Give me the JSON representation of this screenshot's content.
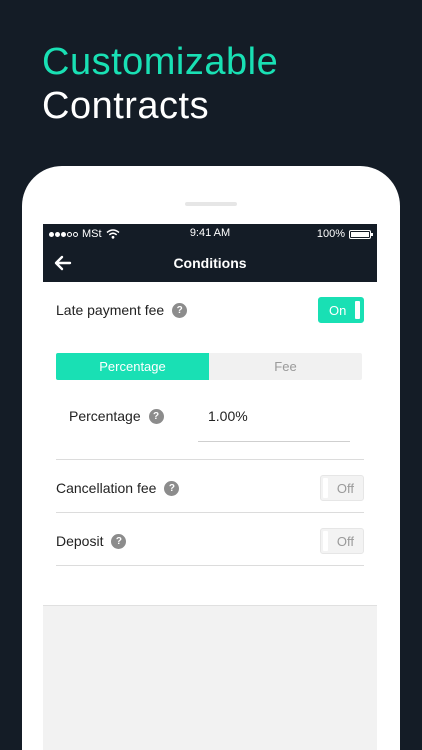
{
  "headline": {
    "line1": "Customizable",
    "line2": "Contracts"
  },
  "status_bar": {
    "carrier": "MSt",
    "time": "9:41 AM",
    "battery": "100%"
  },
  "nav": {
    "title": "Conditions"
  },
  "late_payment": {
    "label": "Late payment fee",
    "help": "?",
    "toggle": "On"
  },
  "segment": {
    "options": [
      "Percentage",
      "Fee"
    ],
    "selected": "Percentage"
  },
  "percentage_field": {
    "label": "Percentage",
    "help": "?",
    "value": "1.00%"
  },
  "cancellation": {
    "label": "Cancellation fee",
    "help": "?",
    "toggle": "Off"
  },
  "deposit": {
    "label": "Deposit",
    "help": "?",
    "toggle": "Off"
  },
  "colors": {
    "accent": "#19e0b4",
    "dark": "#141c26"
  },
  "icons": [
    "signal-icon",
    "wifi-icon",
    "battery-icon",
    "back-arrow-icon",
    "help-icon"
  ]
}
